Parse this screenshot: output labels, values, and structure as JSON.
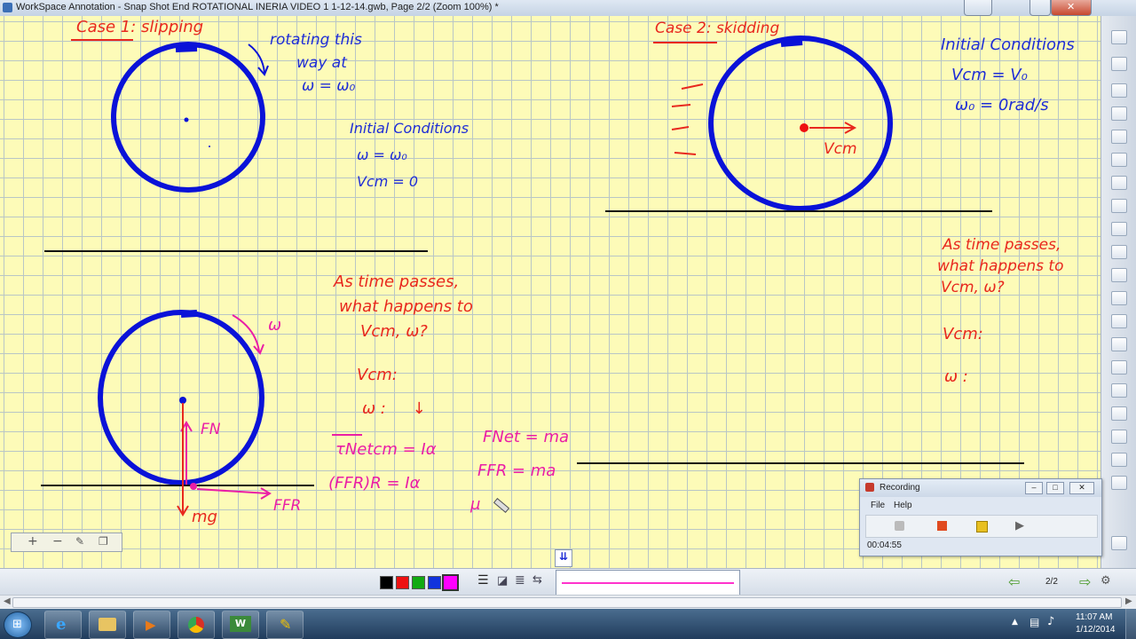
{
  "window": {
    "title": "WorkSpace Annotation - Snap Shot End ROTATIONAL INERIA VIDEO 1 1-12-14.gwb, Page 2/2  (Zoom 100%) *"
  },
  "case1": {
    "heading": "Case 1: slipping",
    "rotating_note": [
      "rotating this",
      "way at",
      "ω = ω₀"
    ],
    "initial_conditions": {
      "title": "Initial Conditions",
      "line1": "ω = ω₀",
      "line2": "Vcm = 0"
    },
    "question": [
      "As time passes,",
      "what happens to",
      "Vcm,  ω?"
    ],
    "vcm_label": "Vcm:",
    "omega_label": "ω :",
    "omega_arrow": "↓",
    "fbd": {
      "omega": "ω",
      "fn": "FN",
      "mg": "mg",
      "ffr": "FFR"
    },
    "equations": {
      "torque": "τNetcm = Iα",
      "ffr_r": "(FFR)R = Iα",
      "fnet": "FNet = ma",
      "ffr_ma": "FFR = ma",
      "mu": "μ"
    }
  },
  "case2": {
    "heading": "Case 2: skidding",
    "initial_conditions": {
      "title": "Initial Conditions",
      "line1": "Vcm = V₀",
      "line2": "ω₀ = 0rad/s"
    },
    "vcm_arrow_label": "Vcm",
    "question": [
      "As time passes,",
      "what happens to",
      "Vcm,  ω?"
    ],
    "vcm_label": "Vcm:",
    "omega_label": "ω :"
  },
  "toolbar": {
    "colors": [
      "#000000",
      "#ee1111",
      "#11aa11",
      "#1133dd",
      "#ff00ff"
    ],
    "page_indicator": "2/2",
    "pen_line_color": "#ff33cc"
  },
  "recorder": {
    "title": "Recording",
    "menu": [
      "File",
      "Help"
    ],
    "time": "00:04:55"
  },
  "taskbar": {
    "time": "11:07 AM",
    "date": "1/12/2014"
  },
  "colors": {
    "red_ink": "#e8281e",
    "blue_ink": "#1e2dd6",
    "magenta_ink": "#ea1ea6",
    "circle_blue": "#0a12d8"
  }
}
